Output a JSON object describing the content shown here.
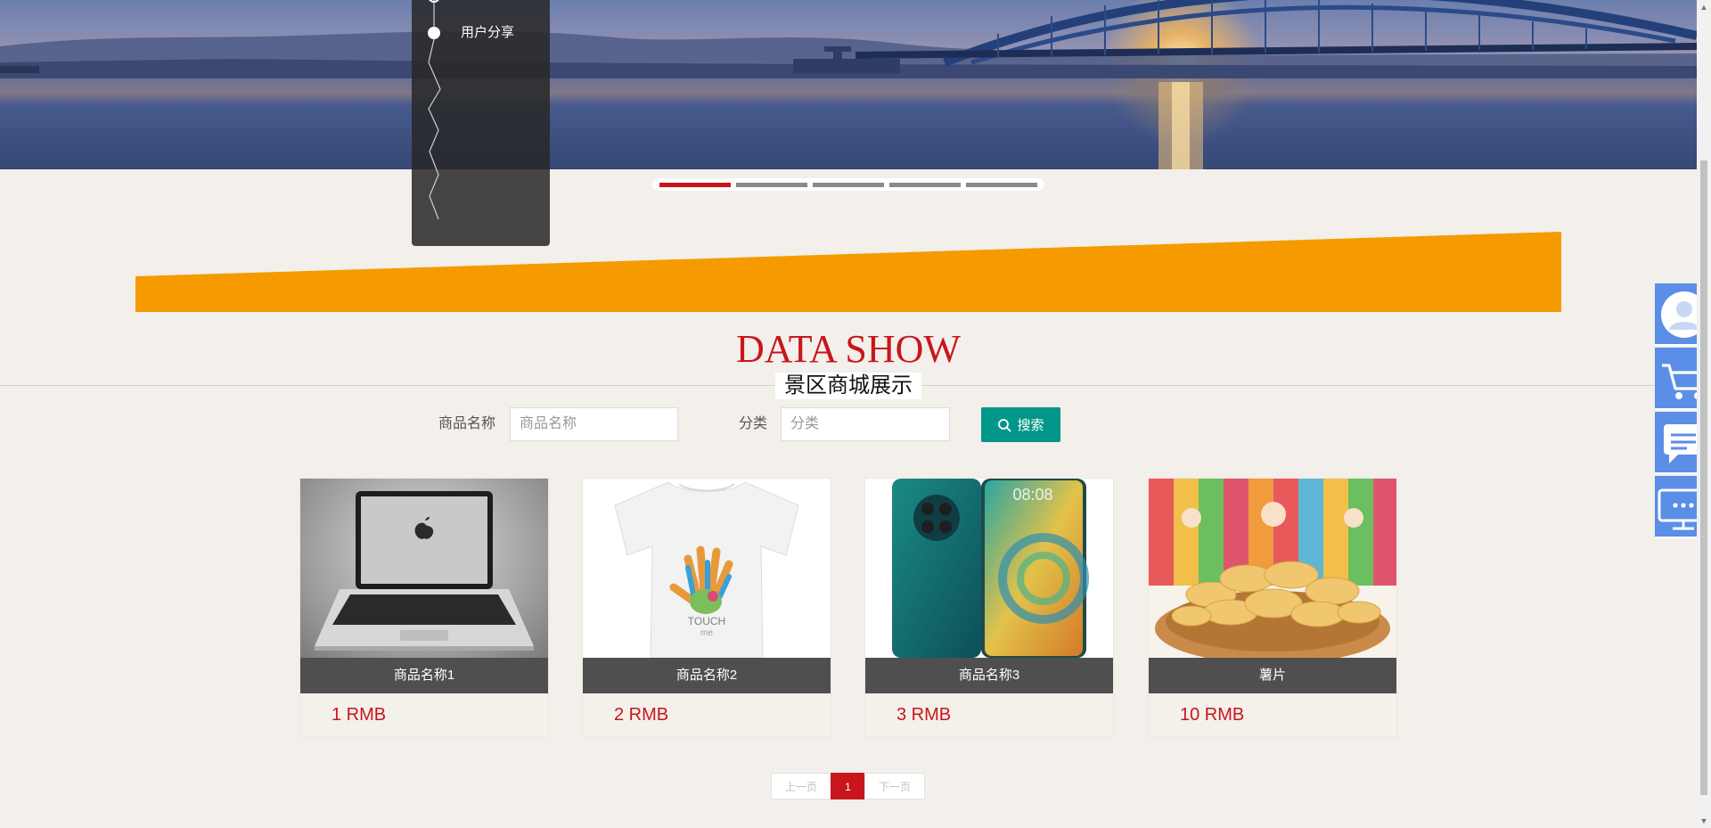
{
  "banner": {
    "slide_count": 5,
    "active_slide": 1
  },
  "side_menu": {
    "items": [
      {
        "label": "用户分享"
      }
    ]
  },
  "section": {
    "title": "DATA SHOW",
    "subtitle": "景区商城展示"
  },
  "search": {
    "name_label": "商品名称",
    "name_placeholder": "商品名称",
    "category_label": "分类",
    "category_placeholder": "分类",
    "button_label": "搜索",
    "button_icon": "search-icon"
  },
  "products": [
    {
      "name": "商品名称1",
      "price": "1 RMB",
      "image": "laptop"
    },
    {
      "name": "商品名称2",
      "price": "2 RMB",
      "image": "t-shirt"
    },
    {
      "name": "商品名称3",
      "price": "3 RMB",
      "image": "smartphone"
    },
    {
      "name": "薯片",
      "price": "10 RMB",
      "image": "potato-chips"
    }
  ],
  "pagination": {
    "prev_label": "上一页",
    "current_page": "1",
    "next_label": "下一页"
  },
  "side_tools": [
    {
      "icon": "user-icon"
    },
    {
      "icon": "cart-icon"
    },
    {
      "icon": "message-icon"
    },
    {
      "icon": "monitor-chat-icon"
    }
  ],
  "colors": {
    "page_bg": "#f3efea",
    "accent_red": "#c8161d",
    "accent_orange": "#f59b00",
    "search_teal": "#009688",
    "tool_blue": "#5b8ee6",
    "name_bar": "#4f4f4f"
  }
}
